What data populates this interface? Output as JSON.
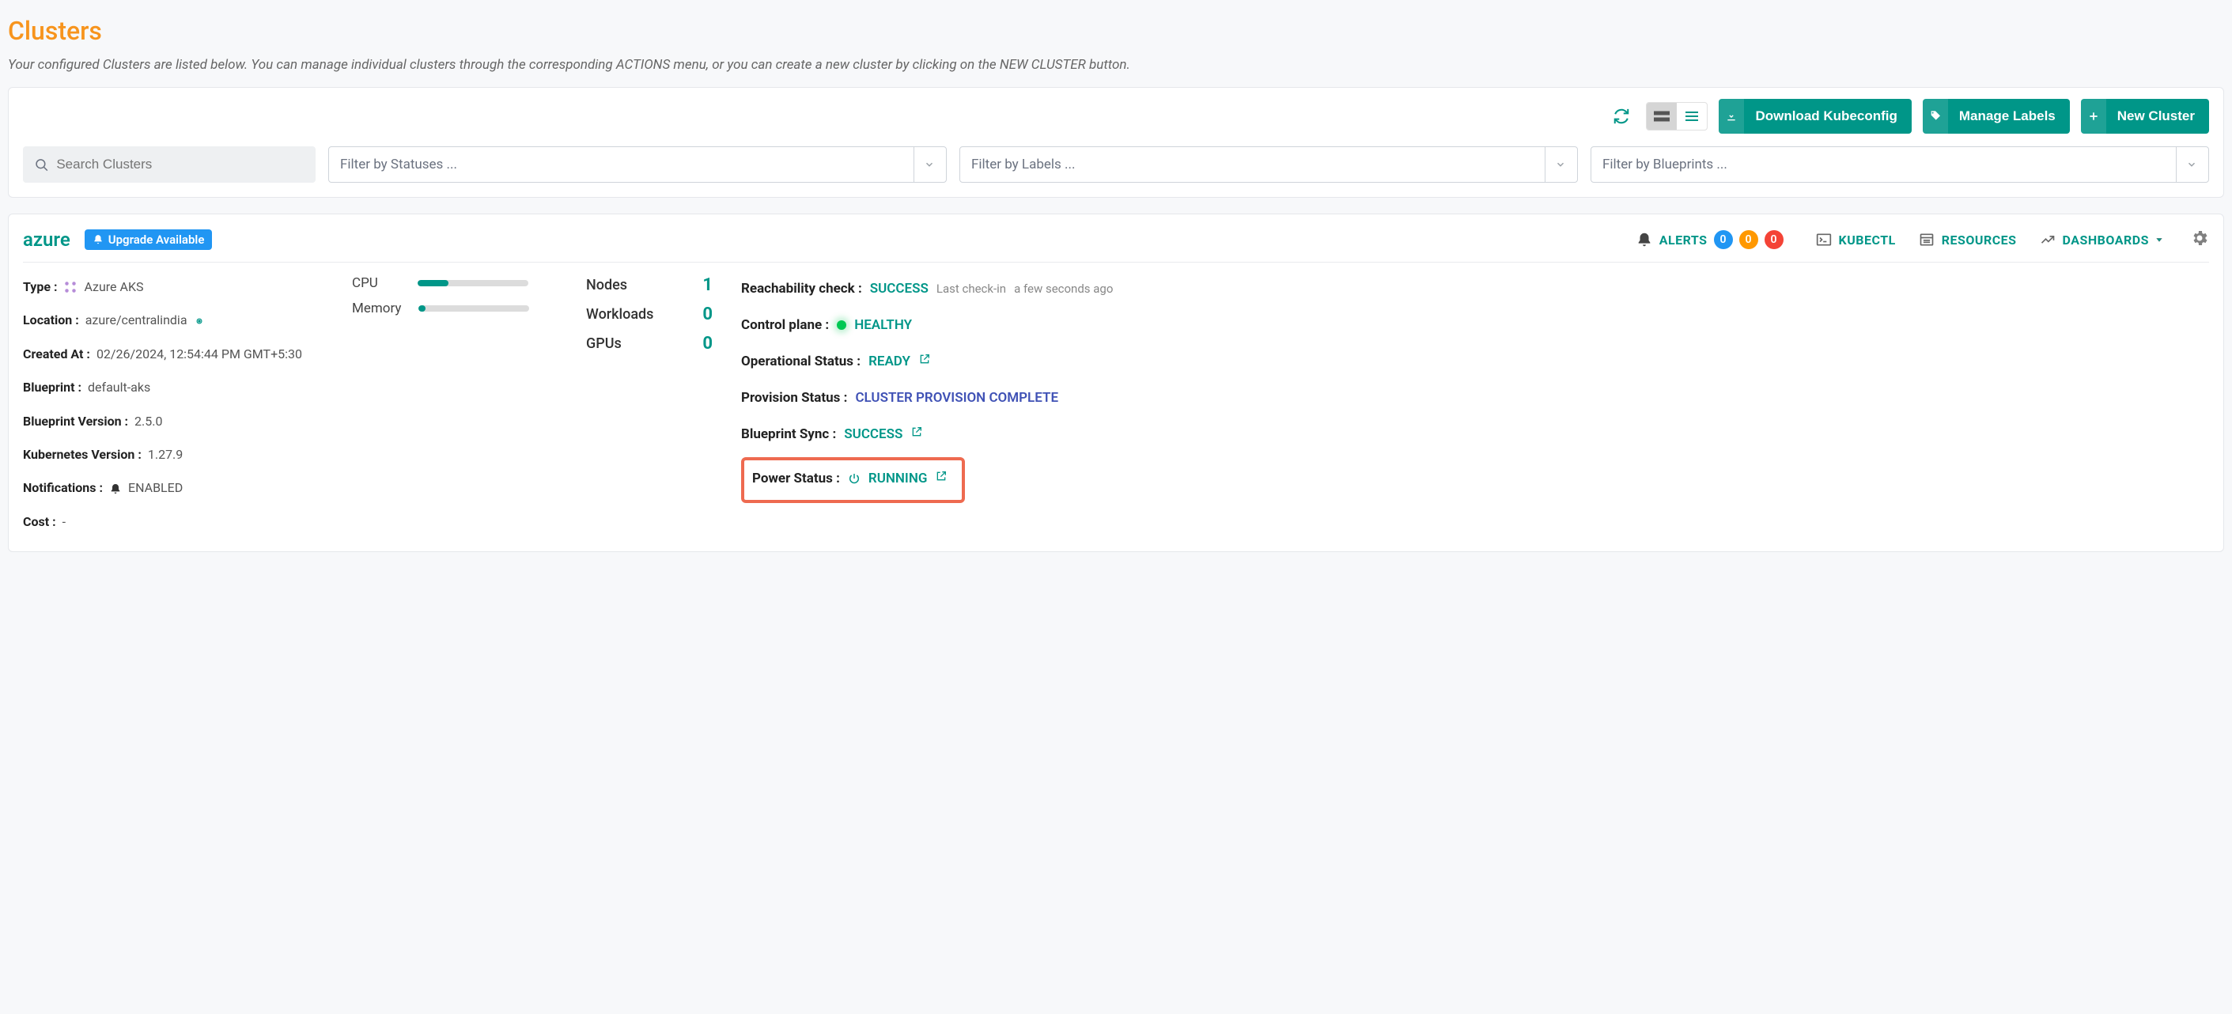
{
  "page": {
    "title": "Clusters",
    "subtitle": "Your configured Clusters are listed below. You can manage individual clusters through the corresponding ACTIONS menu, or you can create a new cluster by clicking on the NEW CLUSTER button."
  },
  "toolbar": {
    "download_kubeconfig": "Download Kubeconfig",
    "manage_labels": "Manage Labels",
    "new_cluster": "New Cluster"
  },
  "filters": {
    "search_placeholder": "Search Clusters",
    "status_placeholder": "Filter by Statuses ...",
    "labels_placeholder": "Filter by Labels ...",
    "blueprints_placeholder": "Filter by Blueprints ..."
  },
  "cluster": {
    "name": "azure",
    "upgrade_badge": "Upgrade Available",
    "header_links": {
      "alerts": "ALERTS",
      "kubectl": "KUBECTL",
      "resources": "RESOURCES",
      "dashboards": "DASHBOARDS"
    },
    "alerts": {
      "info": "0",
      "warn": "0",
      "error": "0"
    },
    "info": {
      "type_label": "Type :",
      "type_value": "Azure AKS",
      "location_label": "Location :",
      "location_value": "azure/centralindia",
      "created_label": "Created At :",
      "created_value": "02/26/2024, 12:54:44 PM GMT+5:30",
      "blueprint_label": "Blueprint :",
      "blueprint_value": "default-aks",
      "blueprint_version_label": "Blueprint Version :",
      "blueprint_version_value": "2.5.0",
      "k8s_version_label": "Kubernetes Version :",
      "k8s_version_value": "1.27.9",
      "notifications_label": "Notifications :",
      "notifications_value": "ENABLED",
      "cost_label": "Cost :",
      "cost_value": "-"
    },
    "meters": {
      "cpu_label": "CPU",
      "cpu_pct": "28%",
      "memory_label": "Memory",
      "memory_pct": "6%"
    },
    "counts": {
      "nodes_label": "Nodes",
      "nodes_value": "1",
      "workloads_label": "Workloads",
      "workloads_value": "0",
      "gpus_label": "GPUs",
      "gpus_value": "0"
    },
    "status": {
      "reachability_label": "Reachability check :",
      "reachability_value": "SUCCESS",
      "last_checkin_label": "Last check-in",
      "last_checkin_value": "a few seconds ago",
      "control_plane_label": "Control plane :",
      "control_plane_value": "HEALTHY",
      "operational_label": "Operational Status :",
      "operational_value": "READY",
      "provision_label": "Provision Status :",
      "provision_value": "CLUSTER PROVISION COMPLETE",
      "blueprint_sync_label": "Blueprint Sync :",
      "blueprint_sync_value": "SUCCESS",
      "power_label": "Power Status :",
      "power_value": "RUNNING"
    }
  }
}
